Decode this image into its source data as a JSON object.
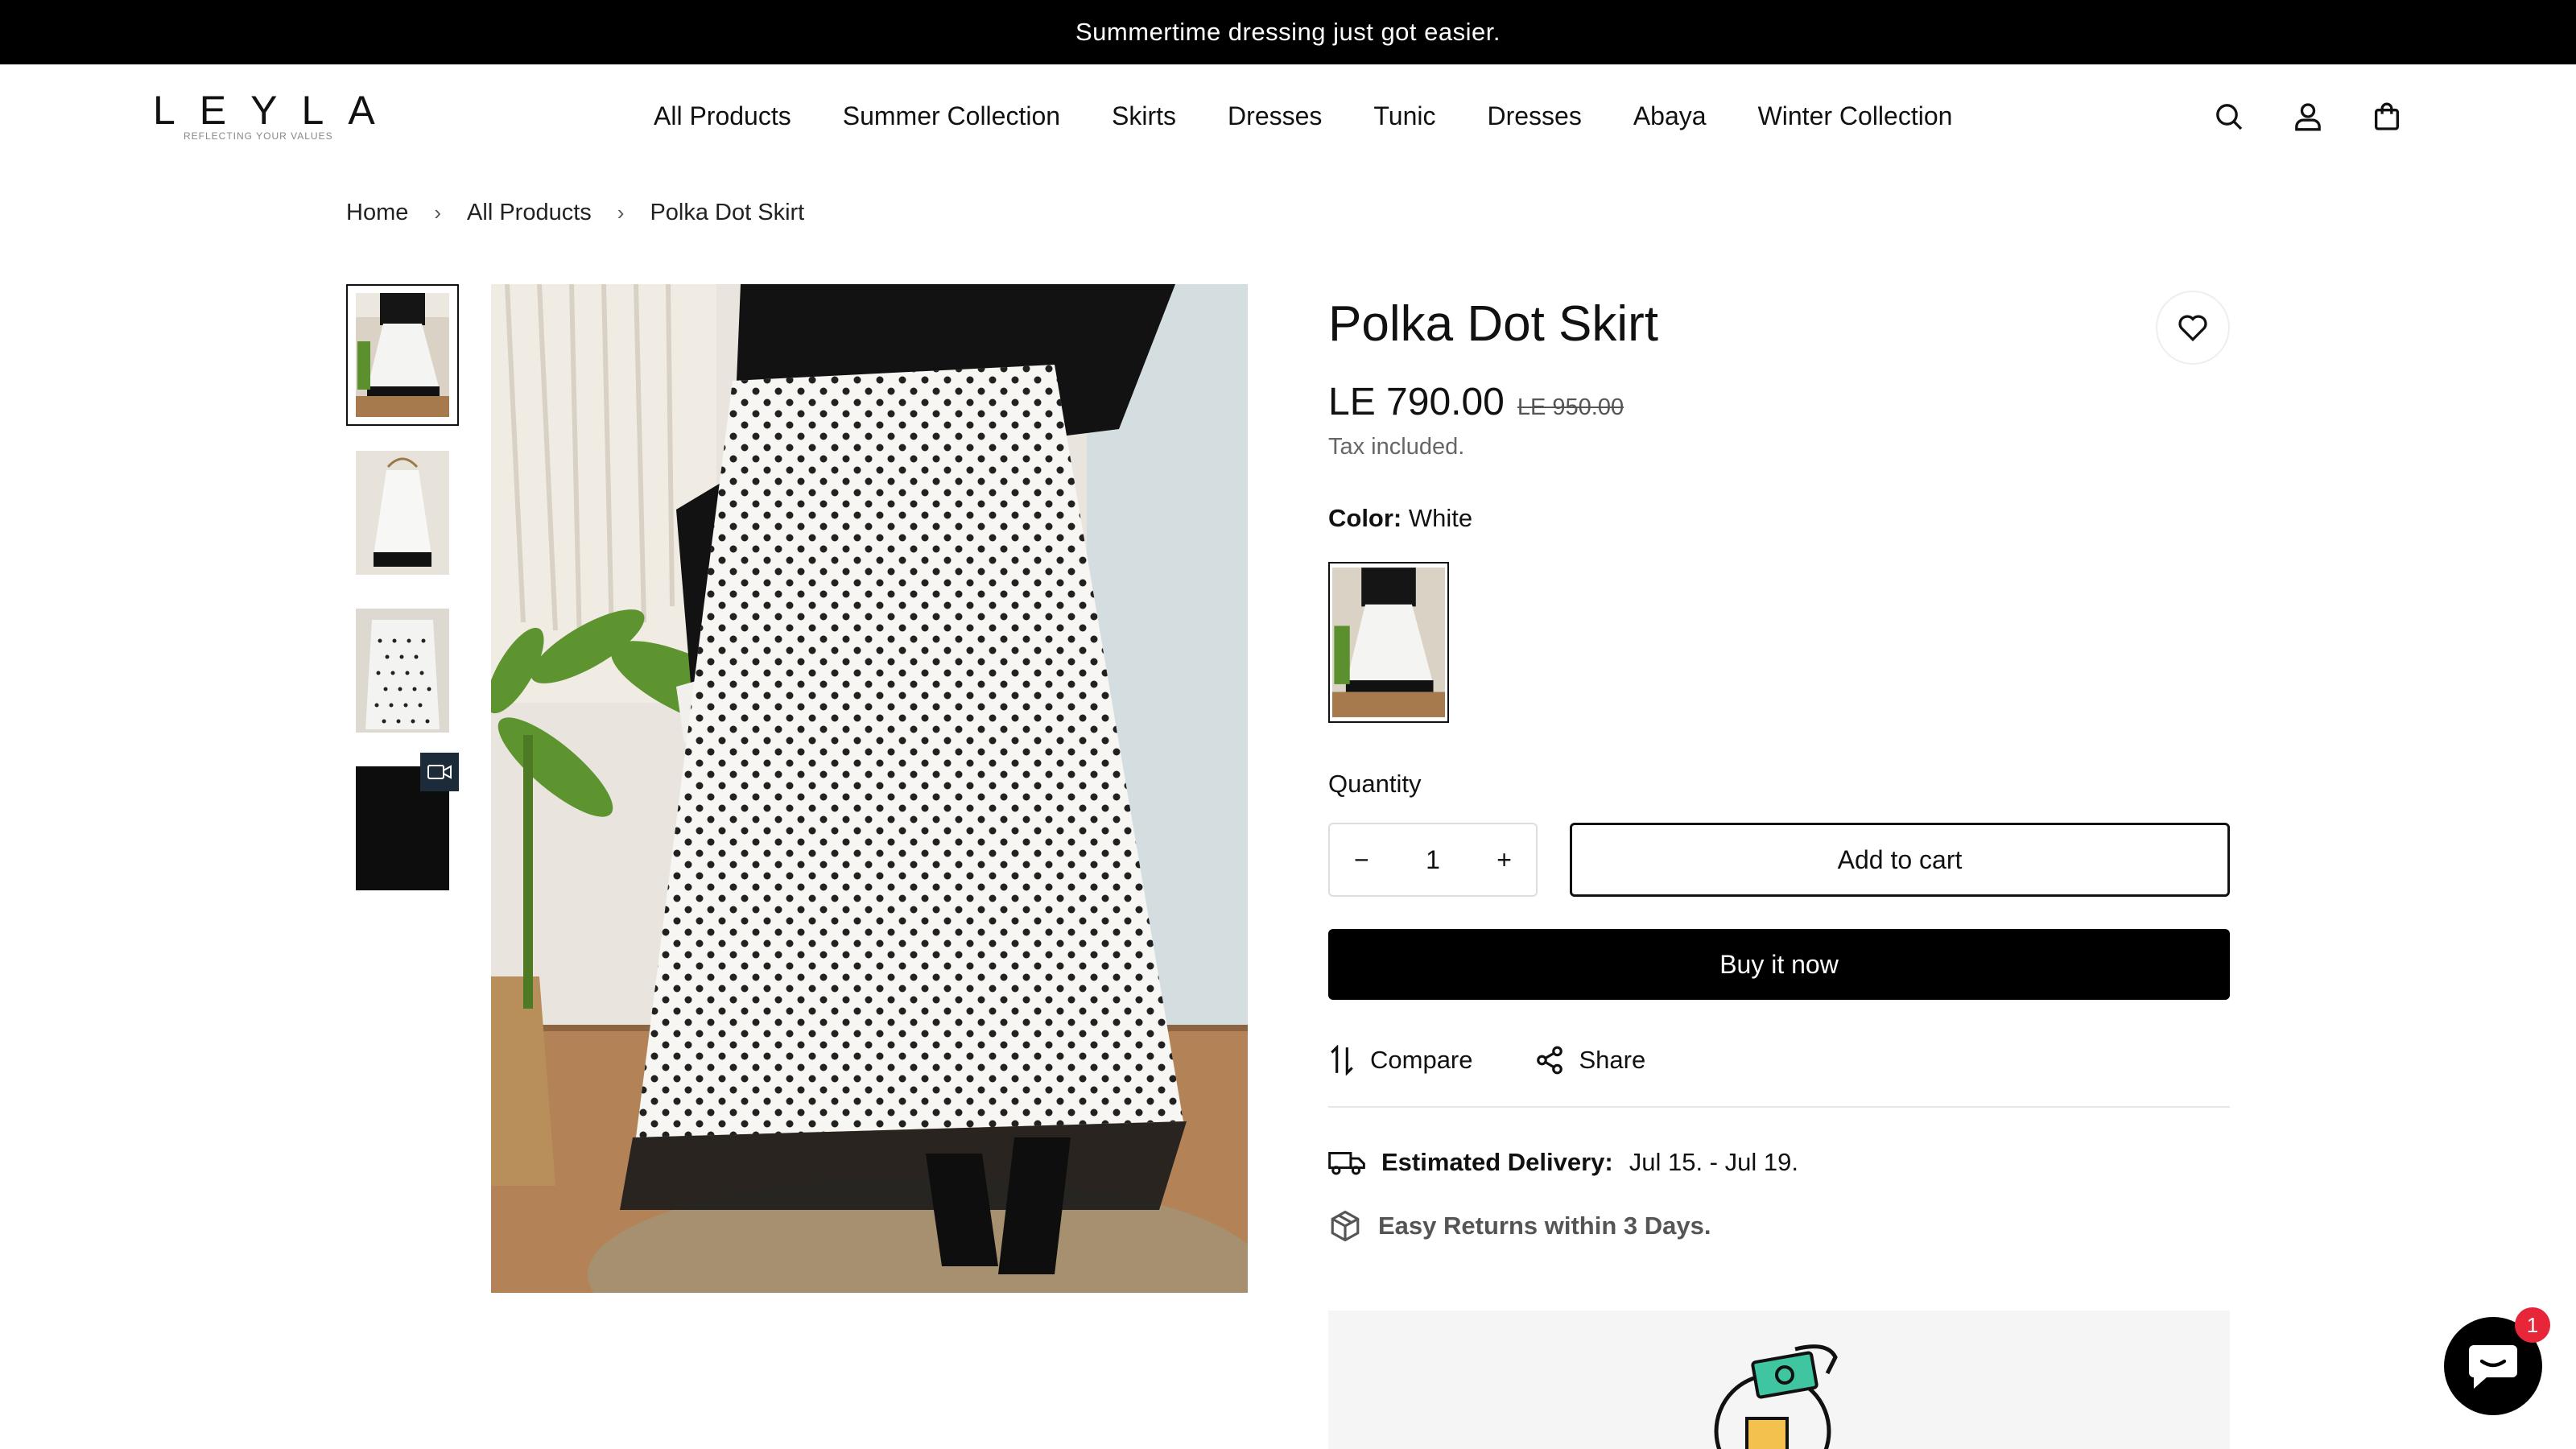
{
  "announcement": "Summertime dressing just got easier.",
  "brand": {
    "name": "LEYLA",
    "tagline": "REFLECTING YOUR VALUES"
  },
  "nav": [
    "All Products",
    "Summer Collection",
    "Skirts",
    "Dresses",
    "Tunic",
    "Dresses",
    "Abaya",
    "Winter Collection"
  ],
  "header_icons": [
    "search-icon",
    "account-icon",
    "cart-icon"
  ],
  "breadcrumb": [
    "Home",
    "All Products",
    "Polka Dot Skirt"
  ],
  "product": {
    "title": "Polka Dot Skirt",
    "price": "LE 790.00",
    "compare_price": "LE 950.00",
    "tax_note": "Tax included.",
    "color_label": "Color:",
    "color_value": "White",
    "quantity_label": "Quantity",
    "quantity": "1",
    "add_to_cart": "Add to cart",
    "buy_now": "Buy it now",
    "compare_label": "Compare",
    "share_label": "Share",
    "delivery_label": "Estimated Delivery:",
    "delivery_value": "Jul 15. - Jul 19.",
    "returns_text": "Easy Returns within 3 Days."
  },
  "chat": {
    "unread": "1"
  },
  "colors": {
    "accent": "#000000",
    "badge": "#e8263a"
  }
}
